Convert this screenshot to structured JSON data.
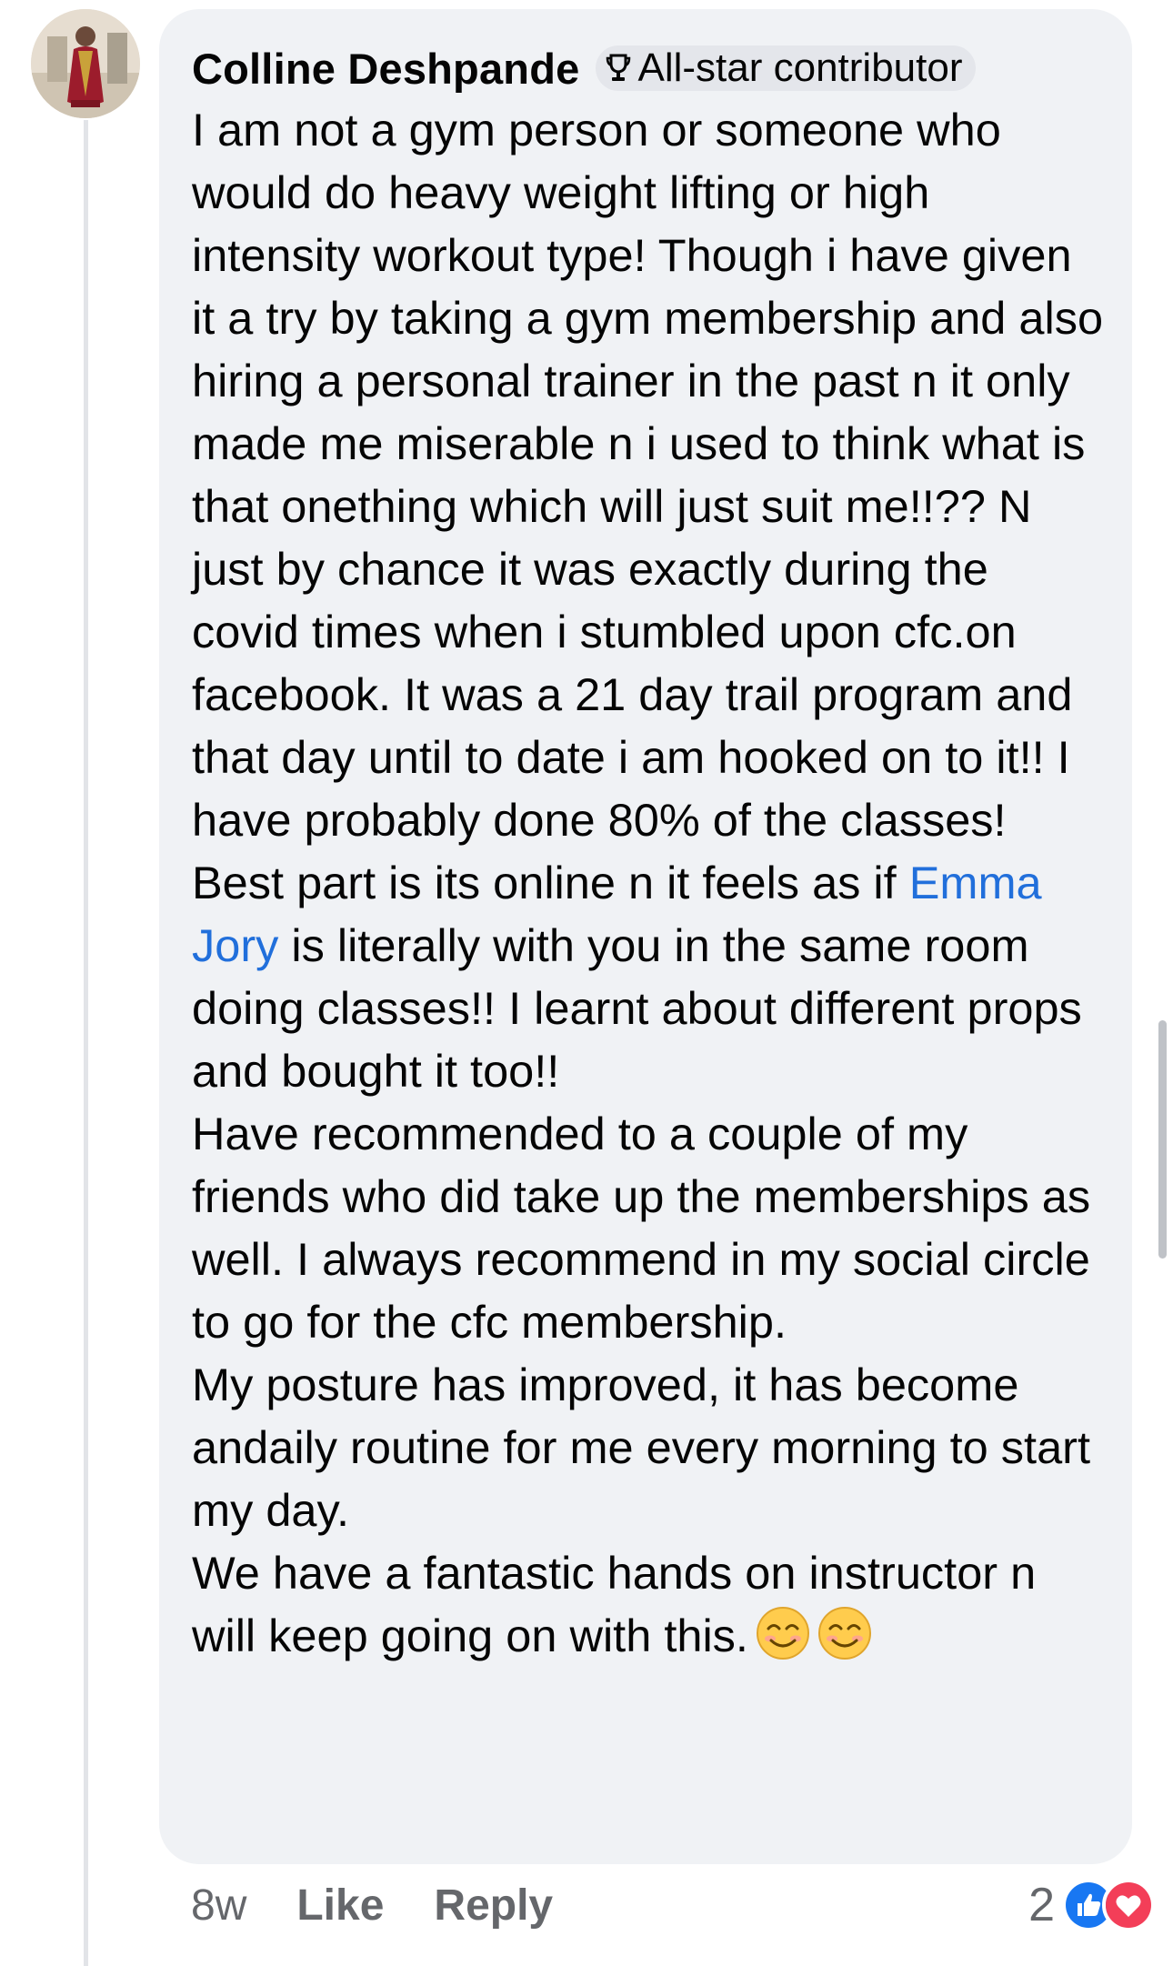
{
  "comment": {
    "author": "Colline Deshpande",
    "badge_label": "All-star contributor",
    "badge_icon": "trophy-icon",
    "avatar_icon": "avatar",
    "paragraphs": {
      "p1_before_mention": "I am not a gym person or someone who would do heavy weight lifting or high intensity workout type! Though i have given it a try by taking a gym membership and also hiring a personal trainer in the past n it only made me miserable n i used to think what is that onething which will just suit me!!?? N just by chance it was exactly during the covid times when i stumbled upon cfc.on facebook. It was a 21 day trail program and that day until to date i am hooked on to it!! I have probably done 80% of the classes! Best part is its online n it feels as if ",
      "p1_mention": "Emma Jory",
      "p1_after_mention": " is literally with you in the same room doing classes!! I learnt about different props and bought it too!!",
      "p2": "Have recommended to a couple of my friends who did take up the memberships as well. I always recommend in my social circle to go for the cfc membership.",
      "p3": "My posture has improved, it has become andaily routine for me every morning to start my day.",
      "p4": "We have a fantastic hands on instructor n will keep going on with this."
    },
    "emojis": [
      "smiling-face-icon",
      "smiling-face-icon"
    ],
    "mention_color": "#216fdb"
  },
  "actions": {
    "time": "8w",
    "like_label": "Like",
    "reply_label": "Reply"
  },
  "reactions": {
    "count": "2",
    "icons": [
      "like-reaction-icon",
      "love-reaction-icon"
    ]
  },
  "colors": {
    "bubble": "#f0f2f5",
    "secondary_text": "#65676b",
    "like_blue": "#1877f2",
    "love_red": "#f33e58"
  }
}
